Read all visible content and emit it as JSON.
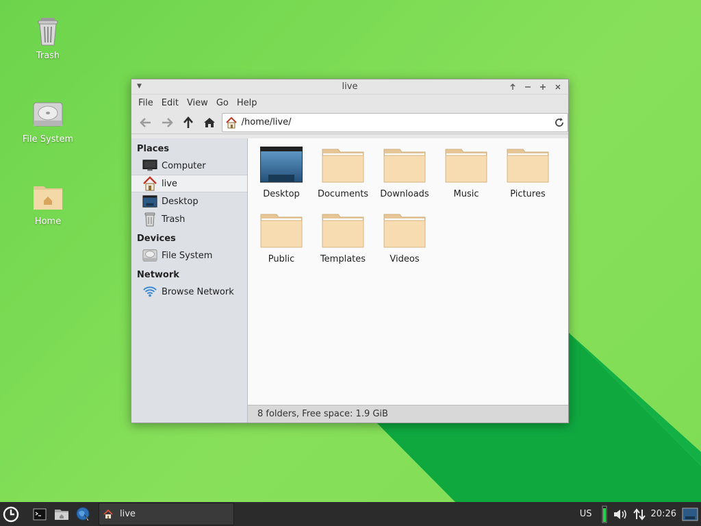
{
  "desktop": {
    "icons": [
      {
        "label": "Trash",
        "icon": "trash-icon"
      },
      {
        "label": "File System",
        "icon": "drive-icon"
      },
      {
        "label": "Home",
        "icon": "home-folder-icon"
      }
    ],
    "colors": {
      "background": "#7fdc55",
      "wedge": "#0fa83f"
    }
  },
  "window": {
    "title": "live",
    "menubar": [
      "File",
      "Edit",
      "View",
      "Go",
      "Help"
    ],
    "location": {
      "path": "/home/live/"
    },
    "sidebar": {
      "sections": [
        {
          "heading": "Places",
          "items": [
            {
              "label": "Computer",
              "icon": "computer-icon"
            },
            {
              "label": "live",
              "icon": "home-icon"
            },
            {
              "label": "Desktop",
              "icon": "desktop-icon"
            },
            {
              "label": "Trash",
              "icon": "trash-icon"
            }
          ]
        },
        {
          "heading": "Devices",
          "items": [
            {
              "label": "File System",
              "icon": "drive-icon"
            }
          ]
        },
        {
          "heading": "Network",
          "items": [
            {
              "label": "Browse Network",
              "icon": "network-icon"
            }
          ]
        }
      ],
      "selected": "live"
    },
    "files": [
      {
        "label": "Desktop",
        "icon": "desktop-folder-icon"
      },
      {
        "label": "Documents",
        "icon": "folder-icon"
      },
      {
        "label": "Downloads",
        "icon": "folder-icon"
      },
      {
        "label": "Music",
        "icon": "folder-icon"
      },
      {
        "label": "Pictures",
        "icon": "folder-icon"
      },
      {
        "label": "Public",
        "icon": "folder-icon"
      },
      {
        "label": "Templates",
        "icon": "folder-icon"
      },
      {
        "label": "Videos",
        "icon": "folder-icon"
      }
    ],
    "status": "8 folders, Free space: 1.9 GiB"
  },
  "taskbar": {
    "task_label": "live",
    "keyboard_layout": "US",
    "clock": "20:26"
  }
}
